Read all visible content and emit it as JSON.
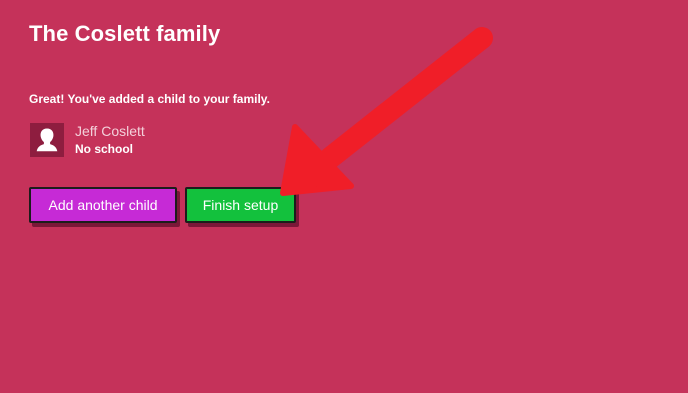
{
  "page": {
    "family_title": "The Coslett family",
    "success_message": "Great! You've added a child to your family."
  },
  "child": {
    "name": "Jeff Coslett",
    "school": "No school",
    "avatar_icon": "person-silhouette-icon"
  },
  "actions": {
    "add_another_label": "Add another child",
    "finish_label": "Finish setup"
  },
  "annotation": {
    "arrow_icon": "red-arrow-icon",
    "arrow_color": "#f01e28"
  },
  "colors": {
    "background": "#c5325a",
    "add_button": "#c62ad6",
    "finish_button": "#13c13d",
    "avatar_bg": "#8e1d3f"
  }
}
